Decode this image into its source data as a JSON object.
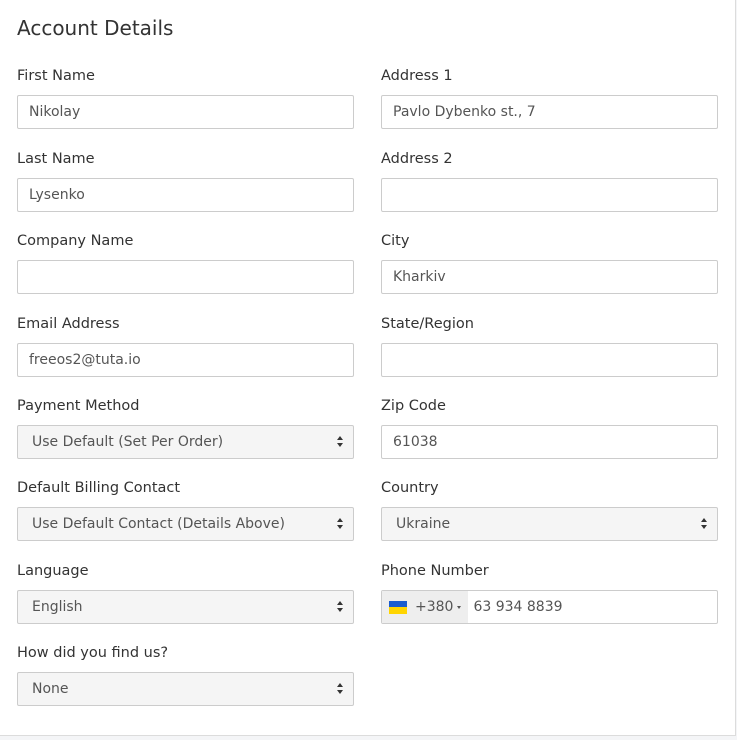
{
  "title": "Account Details",
  "left": {
    "first_name": {
      "label": "First Name",
      "value": "Nikolay"
    },
    "last_name": {
      "label": "Last Name",
      "value": "Lysenko"
    },
    "company_name": {
      "label": "Company Name",
      "value": ""
    },
    "email": {
      "label": "Email Address",
      "value": "freeos2@tuta.io"
    },
    "payment_method": {
      "label": "Payment Method",
      "value": "Use Default (Set Per Order)"
    },
    "billing_contact": {
      "label": "Default Billing Contact",
      "value": "Use Default Contact (Details Above)"
    },
    "language": {
      "label": "Language",
      "value": "English"
    },
    "find_us": {
      "label": "How did you find us?",
      "value": "None"
    }
  },
  "right": {
    "address1": {
      "label": "Address 1",
      "value": "Pavlo Dybenko st., 7"
    },
    "address2": {
      "label": "Address 2",
      "value": ""
    },
    "city": {
      "label": "City",
      "value": "Kharkiv"
    },
    "state": {
      "label": "State/Region",
      "value": ""
    },
    "zip": {
      "label": "Zip Code",
      "value": "61038"
    },
    "country": {
      "label": "Country",
      "value": "Ukraine"
    },
    "phone": {
      "label": "Phone Number",
      "dial_code": "+380",
      "value": "63 934 8839",
      "flag": "ukraine-flag-icon"
    }
  },
  "colors": {
    "flag_blue": "#1a5ccf",
    "flag_yellow": "#ffd500",
    "border": "#cccccc",
    "select_bg": "#f5f5f5"
  }
}
